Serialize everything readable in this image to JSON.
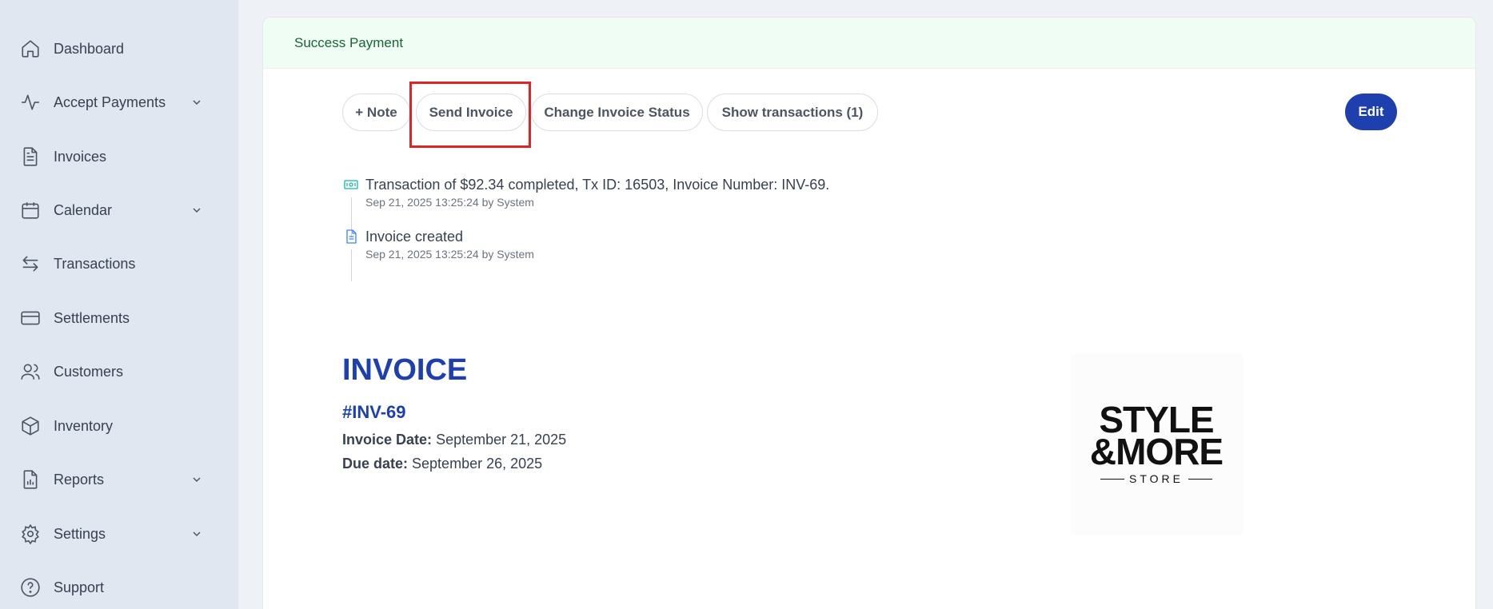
{
  "sidebar": {
    "items": [
      {
        "label": "Dashboard",
        "icon": "home-icon",
        "has_submenu": false
      },
      {
        "label": "Accept Payments",
        "icon": "activity-icon",
        "has_submenu": true
      },
      {
        "label": "Invoices",
        "icon": "document-icon",
        "has_submenu": false
      },
      {
        "label": "Calendar",
        "icon": "calendar-icon",
        "has_submenu": true
      },
      {
        "label": "Transactions",
        "icon": "arrows-icon",
        "has_submenu": false
      },
      {
        "label": "Settlements",
        "icon": "card-icon",
        "has_submenu": false
      },
      {
        "label": "Customers",
        "icon": "users-icon",
        "has_submenu": false
      },
      {
        "label": "Inventory",
        "icon": "box-icon",
        "has_submenu": false
      },
      {
        "label": "Reports",
        "icon": "report-icon",
        "has_submenu": true
      },
      {
        "label": "Settings",
        "icon": "gear-icon",
        "has_submenu": true
      },
      {
        "label": "Support",
        "icon": "help-icon",
        "has_submenu": false
      }
    ]
  },
  "alert": {
    "text": "Success Payment"
  },
  "actions": {
    "note": "+ Note",
    "send_invoice": "Send Invoice",
    "change_status": "Change Invoice Status",
    "show_transactions": "Show transactions (1)",
    "edit": "Edit"
  },
  "timeline": [
    {
      "title": "Transaction of $92.34 completed, Tx ID: 16503, Invoice Number: INV-69.",
      "meta": "Sep 21, 2025 13:25:24 by System",
      "icon": "cash-icon"
    },
    {
      "title": "Invoice created",
      "meta": "Sep 21, 2025 13:25:24 by System",
      "icon": "file-icon"
    }
  ],
  "invoice": {
    "heading": "INVOICE",
    "number": "#INV-69",
    "date_label": "Invoice Date:",
    "date_value": "September 21, 2025",
    "due_label": "Due date:",
    "due_value": "September 26, 2025"
  },
  "logo": {
    "line1": "STYLE",
    "line2": "&MORE",
    "line3": "STORE"
  },
  "colors": {
    "accent": "#1e40af",
    "alert_bg": "#f0fdf4",
    "alert_text": "#166534",
    "highlight": "#dc2626",
    "sidebar_bg": "#e1e7f0"
  }
}
